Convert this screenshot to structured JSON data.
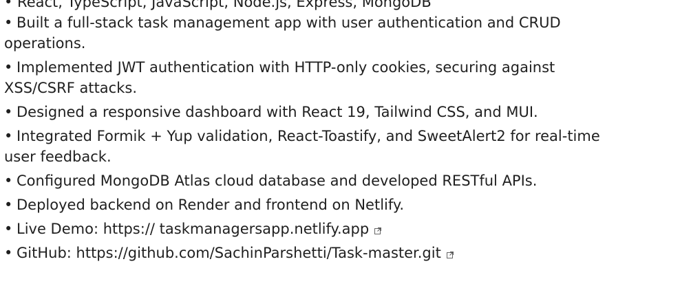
{
  "partial_top_line": "• React, TypeScript, JavaScript, Node.js, Express, MongoDB",
  "bullet_char": "•",
  "items": [
    {
      "line1": "Built a full-stack task management app with user authentication and CRUD",
      "line2": "operations."
    },
    {
      "line1": "Implemented JWT authentication with HTTP-only cookies, securing against",
      "line2": "XSS/CSRF attacks."
    },
    {
      "line1": "Designed a responsive dashboard with React 19, Tailwind CSS, and MUI."
    },
    {
      "line1": "Integrated Formik + Yup validation, React-Toastify, and SweetAlert2 for real-time",
      "line2": "user feedback."
    },
    {
      "line1": "Configured MongoDB Atlas cloud database and developed RESTful APIs."
    },
    {
      "line1": "Deployed backend on Render and frontend on Netlify."
    }
  ],
  "links": [
    {
      "label": "Live Demo: ",
      "url": "https:// taskmanagersapp.netlify.app",
      "icon": "external-link-icon"
    },
    {
      "label": "GitHub: ",
      "url": "https://github.com/SachinParshetti/Task-master.git",
      "icon": "external-link-icon"
    }
  ]
}
